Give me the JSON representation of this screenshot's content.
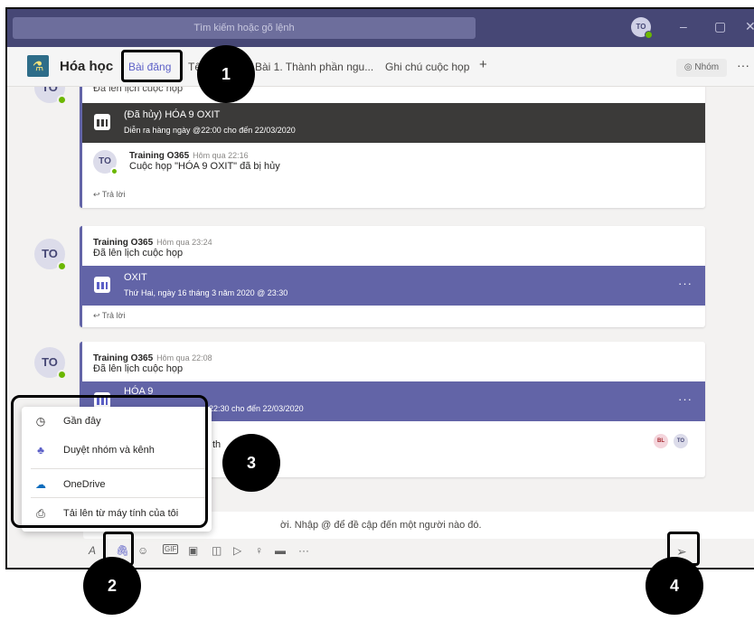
{
  "titlebar": {
    "search_placeholder": "Tìm kiếm hoặc gõ lệnh",
    "avatar": "TO",
    "minimize": "–",
    "restore": "▢",
    "close": "✕"
  },
  "header": {
    "team_name": "Hóa học",
    "tabs": [
      "Bài đăng",
      "Tệp",
      "Bài 1. Thành phần ngu...",
      "Ghi chú cuộc họp"
    ],
    "add_tab": "+",
    "team_button": "◎ Nhóm",
    "more": "···"
  },
  "feed": {
    "post1": {
      "partial_text": "Đã lên lịch cuộc họp",
      "meeting_title": "(Đã hủy) HÓA 9 OXIT",
      "meeting_sub": "Diễn ra hàng ngày @22:00 cho đến 22/03/2020",
      "reply_author": "Training O365",
      "reply_time": "Hôm qua 22:16",
      "reply_msg": "Cuộc họp \"HÓA 9 OXIT\" đã bị hủy",
      "reply_link": "↩ Trả lời",
      "avatar": "TO"
    },
    "post2": {
      "avatar": "TO",
      "author": "Training O365",
      "time": "Hôm qua 23:24",
      "msg": "Đã lên lịch cuộc họp",
      "meeting_title": "OXIT",
      "meeting_sub": "Thứ Hai, ngày 16 tháng 3 năm 2020 @ 23:30",
      "dots": "···",
      "reply_link": "↩ Trả lời"
    },
    "post3": {
      "avatar": "TO",
      "author": "Training O365",
      "time": "Hôm qua 22:08",
      "msg": "Đã lên lịch cuộc họp",
      "meeting_title": "HÓA 9",
      "meeting_sub": "22:30 cho đến 22/03/2020",
      "dots": "···",
      "partial_text": "th",
      "participants": [
        "BL",
        "TO"
      ]
    }
  },
  "attach_menu": {
    "items": [
      {
        "icon": "clock-icon",
        "label": "Gần đây"
      },
      {
        "icon": "teams-icon",
        "label": "Duyệt nhóm và kênh"
      },
      {
        "icon": "onedrive-icon",
        "label": "OneDrive"
      },
      {
        "icon": "upload-icon",
        "label": "Tải lên từ máy tính của tôi"
      }
    ]
  },
  "compose": {
    "placeholder": "ời. Nhập @ để đề cập đến một người nào đó."
  },
  "toolbar": {
    "more": "···"
  },
  "annotations": {
    "n1": "1",
    "n2": "2",
    "n3": "3",
    "n4": "4"
  },
  "colors": {
    "titlebar": "#464775",
    "accent": "#6264a7",
    "meeting_canceled": "#3b3a39",
    "meeting_active": "#6264a7",
    "presence": "#6bb700"
  }
}
